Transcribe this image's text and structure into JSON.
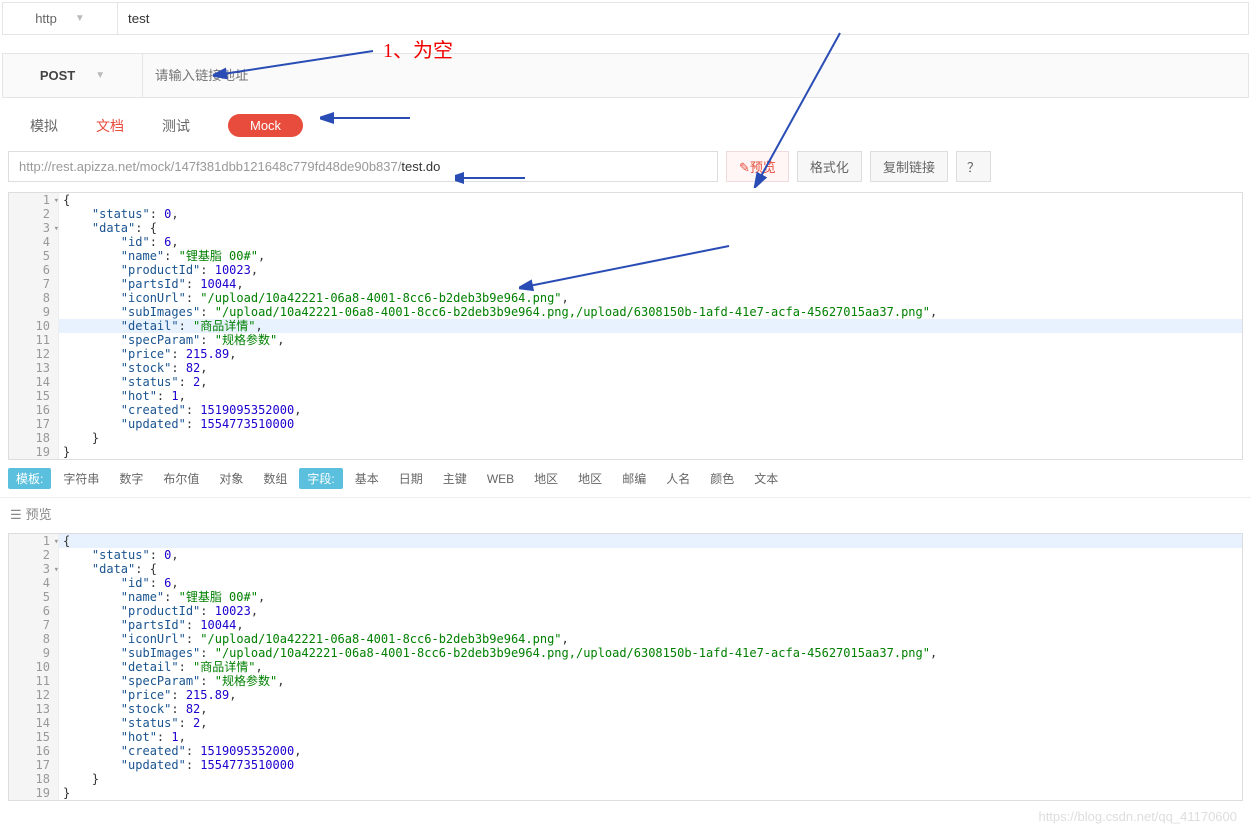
{
  "top": {
    "protocol": "http",
    "name": "test"
  },
  "request": {
    "method": "POST",
    "url_placeholder": "请输入链接地址",
    "annotation": "1、为空"
  },
  "tabs": [
    "模拟",
    "文档",
    "测试"
  ],
  "mock_label": "Mock",
  "mock_url_prefix": "http://rest.apizza.net/mock/147f381dbb121648c779fd48de90b837/",
  "mock_url_suffix": "test.do",
  "buttons": {
    "preview": "预览",
    "format": "格式化",
    "copy_link": "复制链接",
    "help": "？"
  },
  "code_lines": [
    {
      "n": 1,
      "fold": true,
      "ind": 0,
      "raw": "{"
    },
    {
      "n": 2,
      "ind": 1,
      "key": "status",
      "colon": ": ",
      "val": "0",
      "t": "n",
      "comma": true
    },
    {
      "n": 3,
      "fold": true,
      "ind": 1,
      "key": "data",
      "colon": ": ",
      "raw_after": "{"
    },
    {
      "n": 4,
      "ind": 2,
      "key": "id",
      "colon": ": ",
      "val": "6",
      "t": "n",
      "comma": true
    },
    {
      "n": 5,
      "ind": 2,
      "key": "name",
      "colon": ": ",
      "val": "\"锂基脂 00#\"",
      "t": "s",
      "comma": true
    },
    {
      "n": 6,
      "ind": 2,
      "key": "productId",
      "colon": ": ",
      "val": "10023",
      "t": "n",
      "comma": true
    },
    {
      "n": 7,
      "ind": 2,
      "key": "partsId",
      "colon": ": ",
      "val": "10044",
      "t": "n",
      "comma": true
    },
    {
      "n": 8,
      "ind": 2,
      "key": "iconUrl",
      "colon": ": ",
      "val": "\"/upload/10a42221-06a8-4001-8cc6-b2deb3b9e964.png\"",
      "t": "s",
      "comma": true
    },
    {
      "n": 9,
      "ind": 2,
      "key": "subImages",
      "colon": ": ",
      "val": "\"/upload/10a42221-06a8-4001-8cc6-b2deb3b9e964.png,/upload/6308150b-1afd-41e7-acfa-45627015aa37.png\"",
      "t": "s",
      "comma": true
    },
    {
      "n": 10,
      "hl": true,
      "ind": 2,
      "key": "detail",
      "colon": ": ",
      "val": "\"商品详情\"",
      "t": "s",
      "comma": true
    },
    {
      "n": 11,
      "ind": 2,
      "key": "specParam",
      "colon": ": ",
      "val": "\"规格参数\"",
      "t": "s",
      "comma": true
    },
    {
      "n": 12,
      "ind": 2,
      "key": "price",
      "colon": ": ",
      "val": "215.89",
      "t": "n",
      "comma": true
    },
    {
      "n": 13,
      "ind": 2,
      "key": "stock",
      "colon": ": ",
      "val": "82",
      "t": "n",
      "comma": true
    },
    {
      "n": 14,
      "ind": 2,
      "key": "status",
      "colon": ": ",
      "val": "2",
      "t": "n",
      "comma": true
    },
    {
      "n": 15,
      "ind": 2,
      "key": "hot",
      "colon": ": ",
      "val": "1",
      "t": "n",
      "comma": true
    },
    {
      "n": 16,
      "ind": 2,
      "key": "created",
      "colon": ": ",
      "val": "1519095352000",
      "t": "n",
      "comma": true
    },
    {
      "n": 17,
      "ind": 2,
      "key": "updated",
      "colon": ": ",
      "val": "1554773510000",
      "t": "n"
    },
    {
      "n": 18,
      "ind": 1,
      "raw": "}"
    },
    {
      "n": 19,
      "ind": 0,
      "raw": "}"
    }
  ],
  "templates": {
    "label": "模板:",
    "items": [
      "字符串",
      "数字",
      "布尔值",
      "对象",
      "数组",
      "字段:",
      "基本",
      "日期",
      "主键",
      "WEB",
      "地区",
      "地区",
      "邮编",
      "人名",
      "颜色",
      "文本"
    ],
    "active_index": 5
  },
  "preview_header": "预览",
  "preview_lines": [
    {
      "n": 1,
      "fold": true,
      "hl": true,
      "ind": 0,
      "raw": "{"
    },
    {
      "n": 2,
      "ind": 1,
      "key": "status",
      "colon": ": ",
      "val": "0",
      "t": "n",
      "comma": true
    },
    {
      "n": 3,
      "fold": true,
      "ind": 1,
      "key": "data",
      "colon": ": ",
      "raw_after": "{"
    },
    {
      "n": 4,
      "ind": 2,
      "key": "id",
      "colon": ": ",
      "val": "6",
      "t": "n",
      "comma": true
    },
    {
      "n": 5,
      "ind": 2,
      "key": "name",
      "colon": ": ",
      "val": "\"锂基脂 00#\"",
      "t": "s",
      "comma": true
    },
    {
      "n": 6,
      "ind": 2,
      "key": "productId",
      "colon": ": ",
      "val": "10023",
      "t": "n",
      "comma": true
    },
    {
      "n": 7,
      "ind": 2,
      "key": "partsId",
      "colon": ": ",
      "val": "10044",
      "t": "n",
      "comma": true
    },
    {
      "n": 8,
      "ind": 2,
      "key": "iconUrl",
      "colon": ": ",
      "val": "\"/upload/10a42221-06a8-4001-8cc6-b2deb3b9e964.png\"",
      "t": "s",
      "comma": true
    },
    {
      "n": 9,
      "ind": 2,
      "key": "subImages",
      "colon": ": ",
      "val": "\"/upload/10a42221-06a8-4001-8cc6-b2deb3b9e964.png,/upload/6308150b-1afd-41e7-acfa-45627015aa37.png\"",
      "t": "s",
      "comma": true
    },
    {
      "n": 10,
      "ind": 2,
      "key": "detail",
      "colon": ": ",
      "val": "\"商品详情\"",
      "t": "s",
      "comma": true
    },
    {
      "n": 11,
      "ind": 2,
      "key": "specParam",
      "colon": ": ",
      "val": "\"规格参数\"",
      "t": "s",
      "comma": true
    },
    {
      "n": 12,
      "ind": 2,
      "key": "price",
      "colon": ": ",
      "val": "215.89",
      "t": "n",
      "comma": true
    },
    {
      "n": 13,
      "ind": 2,
      "key": "stock",
      "colon": ": ",
      "val": "82",
      "t": "n",
      "comma": true
    },
    {
      "n": 14,
      "ind": 2,
      "key": "status",
      "colon": ": ",
      "val": "2",
      "t": "n",
      "comma": true
    },
    {
      "n": 15,
      "ind": 2,
      "key": "hot",
      "colon": ": ",
      "val": "1",
      "t": "n",
      "comma": true
    },
    {
      "n": 16,
      "ind": 2,
      "key": "created",
      "colon": ": ",
      "val": "1519095352000",
      "t": "n",
      "comma": true
    },
    {
      "n": 17,
      "ind": 2,
      "key": "updated",
      "colon": ": ",
      "val": "1554773510000",
      "t": "n"
    },
    {
      "n": 18,
      "ind": 1,
      "raw": "}"
    },
    {
      "n": 19,
      "ind": 0,
      "raw": "}"
    }
  ],
  "watermark": "https://blog.csdn.net/qq_41170600"
}
